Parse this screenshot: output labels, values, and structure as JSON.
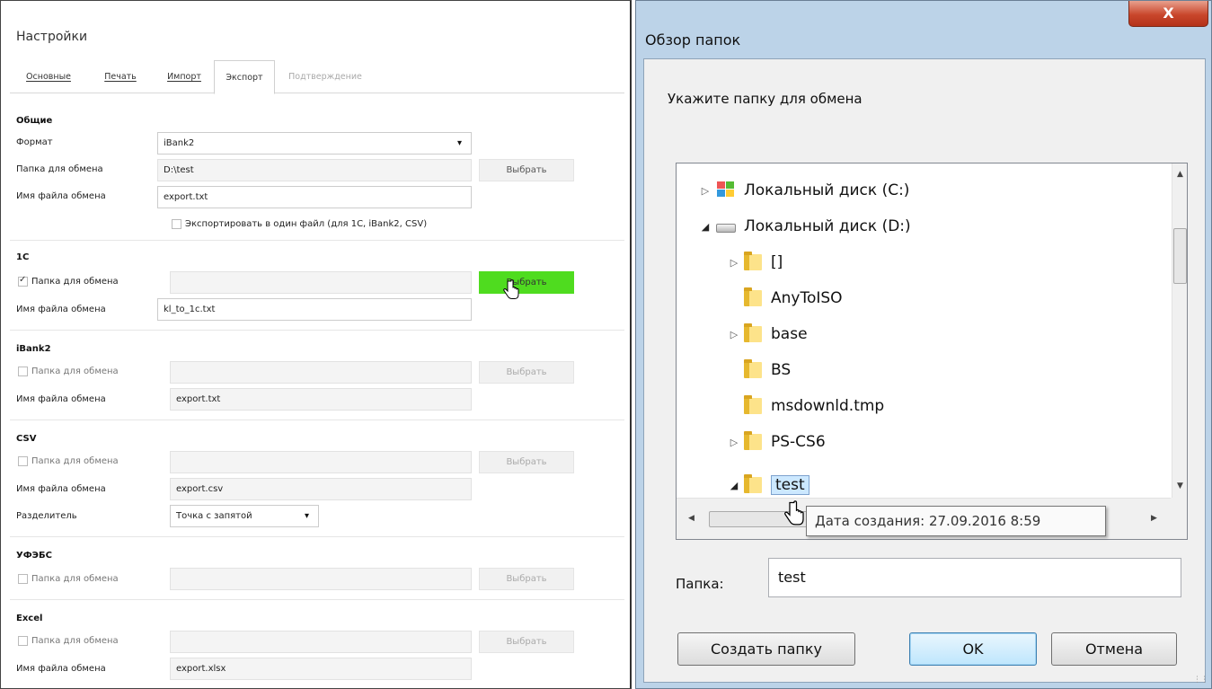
{
  "settings": {
    "title": "Настройки",
    "tabs": [
      "Основные",
      "Печать",
      "Импорт",
      "Экспорт",
      "Подтверждение"
    ],
    "active_tab": "Экспорт",
    "general": {
      "heading": "Общие",
      "format_label": "Формат",
      "format_value": "iBank2",
      "folder_label": "Папка для обмена",
      "folder_value": "D:\\test",
      "choose_label": "Выбрать",
      "file_label": "Имя файла обмена",
      "file_value": "export.txt",
      "single_file_label": "Экспортировать в один файл (для 1С, iBank2, CSV)"
    },
    "c1": {
      "heading": "1С",
      "folder_label": "Папка для обмена",
      "folder_checked": true,
      "choose_label": "Выбрать",
      "file_label": "Имя файла обмена",
      "file_value": "kl_to_1c.txt"
    },
    "ibank2": {
      "heading": "iBank2",
      "folder_label": "Папка для обмена",
      "choose_label": "Выбрать",
      "file_label": "Имя файла обмена",
      "file_value": "export.txt"
    },
    "csv": {
      "heading": "CSV",
      "folder_label": "Папка для обмена",
      "choose_label": "Выбрать",
      "file_label": "Имя файла обмена",
      "file_value": "export.csv",
      "separator_label": "Разделитель",
      "separator_value": "Точка с запятой"
    },
    "ufebs": {
      "heading": "УФЭБС",
      "folder_label": "Папка для обмена",
      "choose_label": "Выбрать"
    },
    "excel": {
      "heading": "Excel",
      "folder_label": "Папка для обмена",
      "choose_label": "Выбрать",
      "file_label": "Имя файла обмена",
      "file_value": "export.xlsx"
    },
    "colors": {
      "accent_green": "#4fdc1f"
    }
  },
  "dialog": {
    "title": "Обзор папок",
    "close_glyph": "X",
    "prompt": "Укажите папку для обмена",
    "tree": [
      {
        "label": "Локальный диск (C:)",
        "icon": "windows-drive-icon",
        "expander": "collapsed"
      },
      {
        "label": "Локальный диск (D:)",
        "icon": "hard-drive-icon",
        "expander": "expanded"
      },
      {
        "label": "[]",
        "icon": "folder-icon",
        "expander": "collapsed"
      },
      {
        "label": "AnyToISO",
        "icon": "folder-icon",
        "expander": "none"
      },
      {
        "label": "base",
        "icon": "folder-icon",
        "expander": "collapsed"
      },
      {
        "label": "BS",
        "icon": "folder-icon",
        "expander": "none"
      },
      {
        "label": "msdownld.tmp",
        "icon": "folder-icon",
        "expander": "none"
      },
      {
        "label": "PS-CS6",
        "icon": "folder-icon",
        "expander": "collapsed"
      },
      {
        "label": "test",
        "icon": "folder-icon",
        "expander": "expanded",
        "selected": true
      }
    ],
    "tooltip": "Дата создания: 27.09.2016 8:59",
    "folder_label": "Папка:",
    "folder_value": "test",
    "buttons": {
      "create": "Создать папку",
      "ok": "OK",
      "cancel": "Отмена"
    }
  }
}
